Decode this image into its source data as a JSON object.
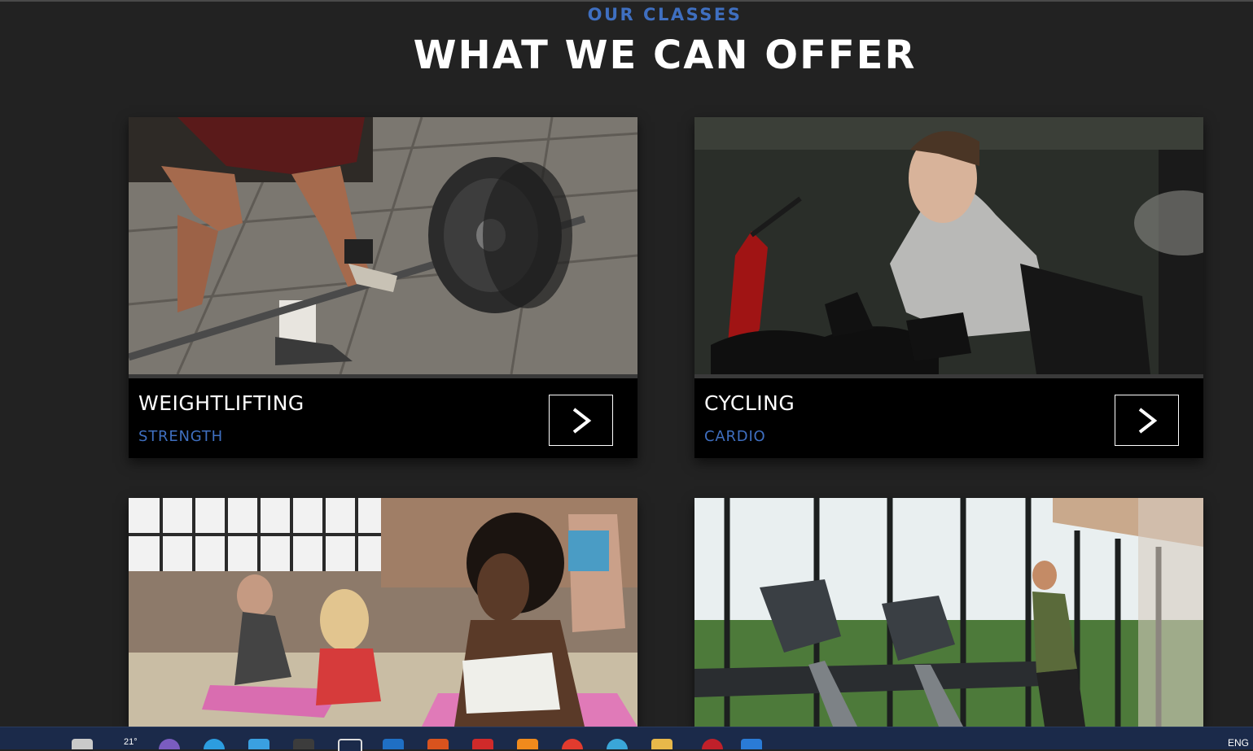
{
  "section": {
    "eyebrow": "OUR CLASSES",
    "headline": "WHAT WE CAN OFFER"
  },
  "cards": [
    {
      "title": "WEIGHTLIFTING",
      "subtitle": "STRENGTH"
    },
    {
      "title": "CYCLING",
      "subtitle": "CARDIO"
    },
    {
      "title": "",
      "subtitle": ""
    },
    {
      "title": "",
      "subtitle": ""
    }
  ],
  "taskbar": {
    "weather": "21°",
    "language": "ENG"
  },
  "colors": {
    "accent": "#3f6fc0",
    "background": "#222222",
    "card_footer": "#000000",
    "taskbar": "#1b2a4a"
  }
}
